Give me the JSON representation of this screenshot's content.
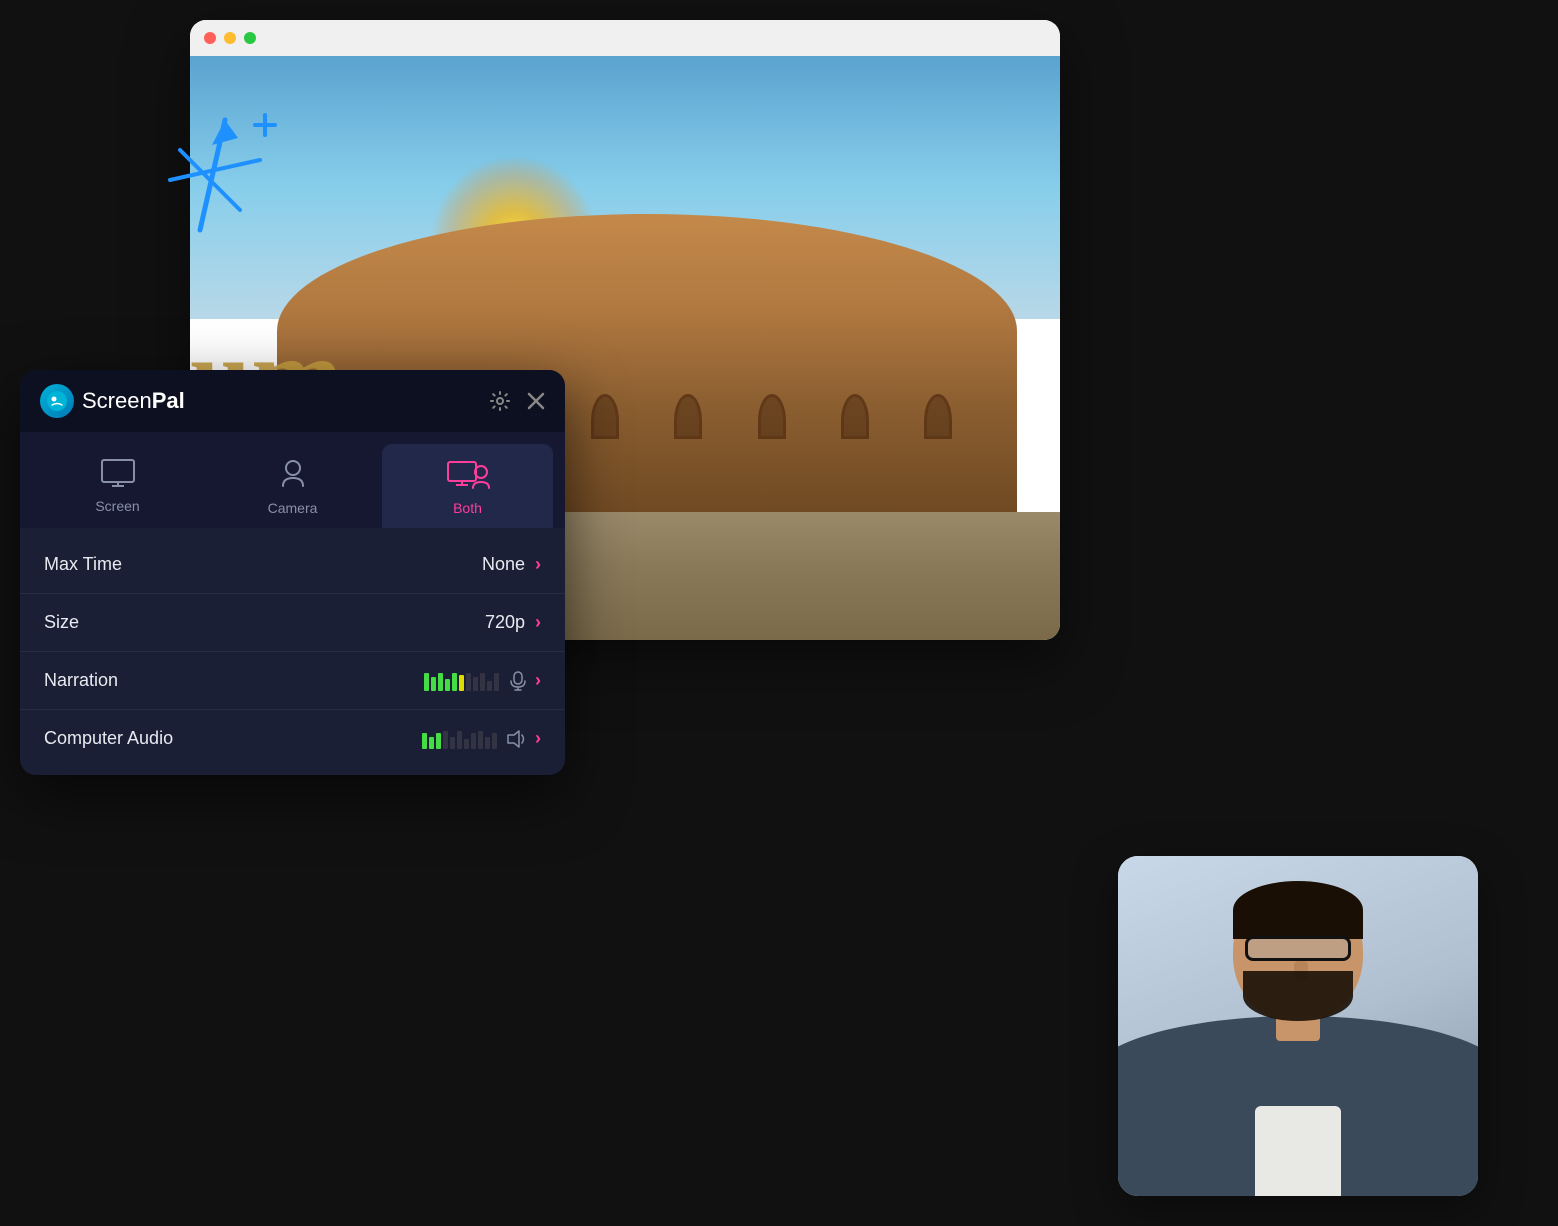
{
  "brand": {
    "icon_symbol": "😊",
    "name_prefix": "Screen",
    "name_suffix": "Pal"
  },
  "header": {
    "settings_label": "⚙",
    "close_label": "✕"
  },
  "tabs": [
    {
      "id": "screen",
      "label": "Screen",
      "icon": "🖥",
      "active": false
    },
    {
      "id": "camera",
      "label": "Camera",
      "icon": "👤",
      "active": false
    },
    {
      "id": "both",
      "label": "Both",
      "icon": "🖥👤",
      "active": true
    }
  ],
  "settings": [
    {
      "id": "max-time",
      "label": "Max Time",
      "value": "None",
      "has_meter": false,
      "has_chevron": true
    },
    {
      "id": "size",
      "label": "Size",
      "value": "720p",
      "has_meter": false,
      "has_chevron": true
    },
    {
      "id": "narration",
      "label": "Narration",
      "value": "",
      "has_meter": true,
      "meter_type": "mic",
      "has_chevron": true
    },
    {
      "id": "computer-audio",
      "label": "Computer Audio",
      "value": "",
      "has_meter": true,
      "meter_type": "speaker",
      "has_chevron": true
    }
  ],
  "background_text": "um",
  "colors": {
    "accent_pink": "#ff3d9a",
    "accent_blue": "#1e90ff",
    "panel_bg": "#1a1f35",
    "panel_header": "#0d1020"
  }
}
